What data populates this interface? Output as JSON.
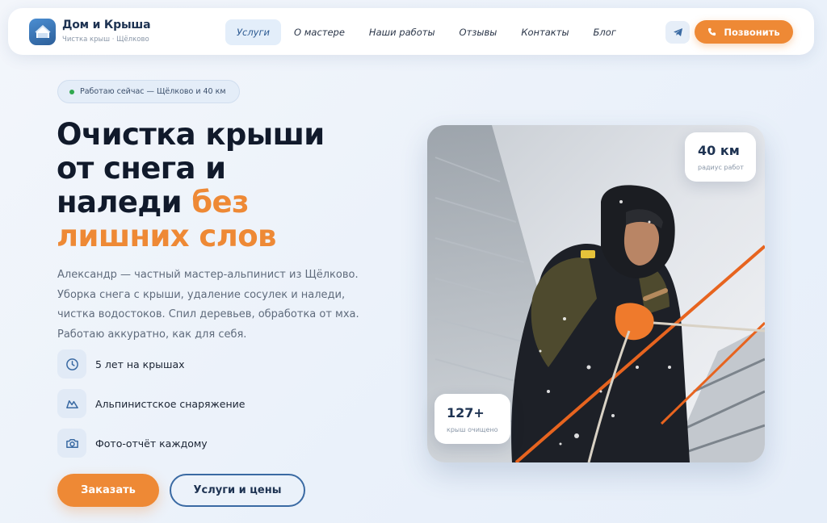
{
  "brand": {
    "title": "Дом и Крыша",
    "subtitle": "Чистка крыш · Щёлково"
  },
  "nav": {
    "items": [
      {
        "label": "Услуги",
        "active": true
      },
      {
        "label": "О мастере"
      },
      {
        "label": "Наши работы"
      },
      {
        "label": "Отзывы"
      },
      {
        "label": "Контакты"
      },
      {
        "label": "Блог"
      }
    ]
  },
  "header": {
    "telegram_icon": "telegram-icon",
    "call_label": "Позвонить"
  },
  "hero": {
    "status": "Работаю сейчас — Щёлково и 40 км",
    "headline_lines": [
      "Очистка крыши",
      "от снега и",
      "наледи"
    ],
    "headline_accent_1": "без",
    "headline_accent_2": "лишних слов",
    "lead": "Александр — частный мастер-альпинист из Щёлково. Уборка снега с крыши, удаление сосулек и наледи, чистка водостоков. Спил деревьев, обработка от мха. Работаю аккуратно, как для себя.",
    "features": [
      {
        "icon": "clock-icon",
        "label": "5 лет на крышах"
      },
      {
        "icon": "mountain-icon",
        "label": "Альпинистское снаряжение"
      },
      {
        "icon": "camera-icon",
        "label": "Фото-отчёт каждому"
      }
    ],
    "order_label": "Заказать",
    "services_label": "Услуги и цены"
  },
  "stats": {
    "radius_value": "40 км",
    "radius_label": "радиус работ",
    "roofs_value": "127+",
    "roofs_label": "крыш очищено"
  },
  "colors": {
    "accent": "#ee8935",
    "primary": "#1e3352",
    "status_dot": "#2fa84f"
  }
}
